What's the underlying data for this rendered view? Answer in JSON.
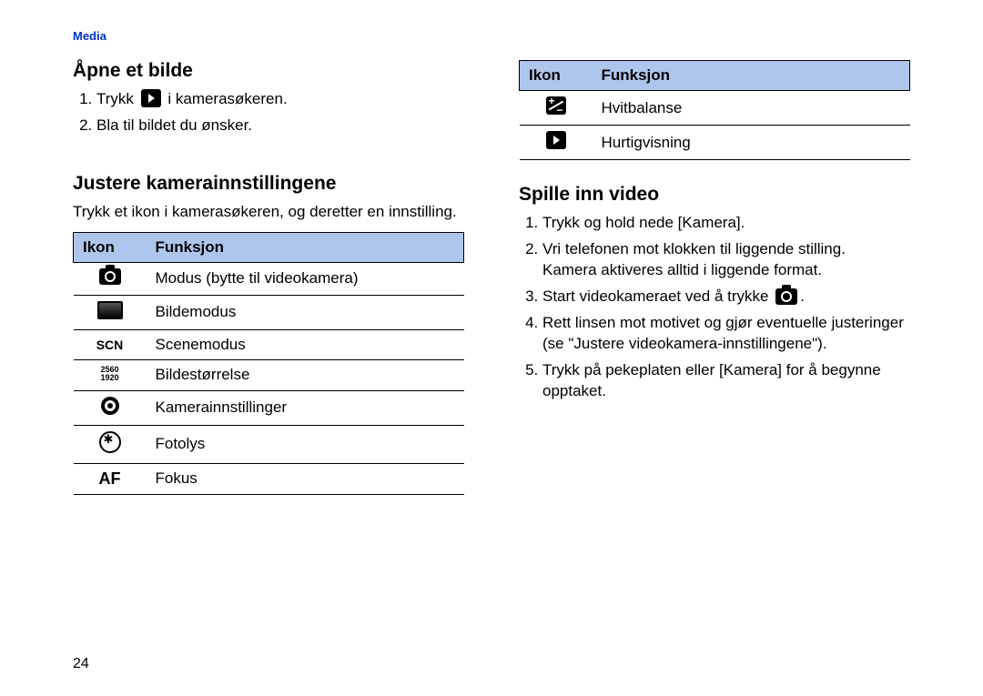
{
  "header_link": "Media",
  "page_number": "24",
  "left": {
    "section1": {
      "title": "Åpne et bilde",
      "steps": [
        {
          "pre": "Trykk ",
          "post": " i kamerasøkeren."
        },
        {
          "text": "Bla til bildet du ønsker."
        }
      ]
    },
    "section2": {
      "title": "Justere kamerainnstillingene",
      "intro": "Trykk et ikon i kamerasøkeren, og deretter en innstilling.",
      "table": {
        "head_icon": "Ikon",
        "head_func": "Funksjon",
        "rows": [
          {
            "icon": "camera",
            "label": "Modus (bytte til videokamera)"
          },
          {
            "icon": "rect",
            "label": "Bildemodus"
          },
          {
            "icon": "scn",
            "label": "Scenemodus",
            "text": "SCN"
          },
          {
            "icon": "res",
            "label": "Bildestørrelse",
            "text_top": "2560",
            "text_bot": "1920"
          },
          {
            "icon": "gear",
            "label": "Kamerainnstillinger"
          },
          {
            "icon": "flash",
            "label": "Fotolys"
          },
          {
            "icon": "af",
            "label": "Fokus",
            "text": "AF"
          }
        ]
      }
    }
  },
  "right": {
    "table": {
      "head_icon": "Ikon",
      "head_func": "Funksjon",
      "rows": [
        {
          "icon": "wb",
          "label": "Hvitbalanse"
        },
        {
          "icon": "play",
          "label": "Hurtigvisning"
        }
      ]
    },
    "section3": {
      "title": "Spille inn video",
      "steps": [
        "Trykk og hold nede [Kamera].",
        "Vri telefonen mot klokken til liggende stilling.\nKamera aktiveres alltid i liggende format.",
        {
          "pre": "Start videokameraet ved å trykke ",
          "post": "."
        },
        "Rett linsen mot motivet og gjør eventuelle justeringer (se \"Justere videokamera-innstillingene\").",
        "Trykk på pekeplaten eller [Kamera] for å begynne opptaket."
      ]
    }
  }
}
